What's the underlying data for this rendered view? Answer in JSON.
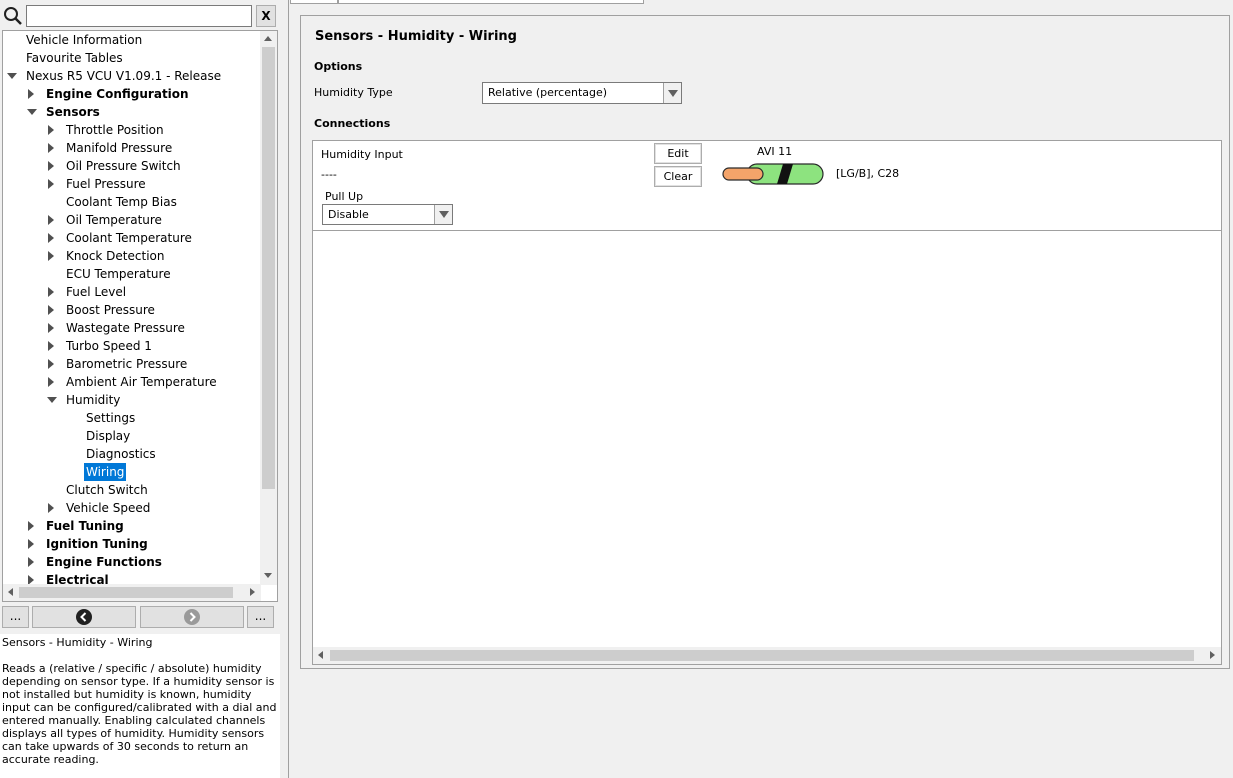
{
  "search": {
    "placeholder": "",
    "value": "",
    "clear_label": "X"
  },
  "tree": {
    "items": [
      {
        "label": "Vehicle Information",
        "level": 0,
        "state": "none",
        "bold": false
      },
      {
        "label": "Favourite Tables",
        "level": 0,
        "state": "none",
        "bold": false
      },
      {
        "label": "Nexus R5 VCU V1.09.1 - Release",
        "level": 0,
        "state": "expanded",
        "bold": false
      },
      {
        "label": "Engine Configuration",
        "level": 1,
        "state": "collapsed",
        "bold": true
      },
      {
        "label": "Sensors",
        "level": 1,
        "state": "expanded",
        "bold": true
      },
      {
        "label": "Throttle Position",
        "level": 2,
        "state": "collapsed",
        "bold": false
      },
      {
        "label": "Manifold Pressure",
        "level": 2,
        "state": "collapsed",
        "bold": false
      },
      {
        "label": "Oil Pressure Switch",
        "level": 2,
        "state": "collapsed",
        "bold": false
      },
      {
        "label": "Fuel Pressure",
        "level": 2,
        "state": "collapsed",
        "bold": false
      },
      {
        "label": "Coolant Temp Bias",
        "level": 2,
        "state": "none",
        "bold": false
      },
      {
        "label": "Oil Temperature",
        "level": 2,
        "state": "collapsed",
        "bold": false
      },
      {
        "label": "Coolant Temperature",
        "level": 2,
        "state": "collapsed",
        "bold": false
      },
      {
        "label": "Knock Detection",
        "level": 2,
        "state": "collapsed",
        "bold": false
      },
      {
        "label": "ECU Temperature",
        "level": 2,
        "state": "none",
        "bold": false
      },
      {
        "label": "Fuel Level",
        "level": 2,
        "state": "collapsed",
        "bold": false
      },
      {
        "label": "Boost Pressure",
        "level": 2,
        "state": "collapsed",
        "bold": false
      },
      {
        "label": "Wastegate Pressure",
        "level": 2,
        "state": "collapsed",
        "bold": false
      },
      {
        "label": "Turbo Speed 1",
        "level": 2,
        "state": "collapsed",
        "bold": false
      },
      {
        "label": "Barometric Pressure",
        "level": 2,
        "state": "collapsed",
        "bold": false
      },
      {
        "label": "Ambient Air Temperature",
        "level": 2,
        "state": "collapsed",
        "bold": false
      },
      {
        "label": "Humidity",
        "level": 2,
        "state": "expanded",
        "bold": false
      },
      {
        "label": "Settings",
        "level": 3,
        "state": "none",
        "bold": false
      },
      {
        "label": "Display",
        "level": 3,
        "state": "none",
        "bold": false
      },
      {
        "label": "Diagnostics",
        "level": 3,
        "state": "none",
        "bold": false
      },
      {
        "label": "Wiring",
        "level": 3,
        "state": "none",
        "bold": false,
        "selected": true
      },
      {
        "label": "Clutch Switch",
        "level": 2,
        "state": "none",
        "bold": false
      },
      {
        "label": "Vehicle Speed",
        "level": 2,
        "state": "collapsed",
        "bold": false
      },
      {
        "label": "Fuel Tuning",
        "level": 1,
        "state": "collapsed",
        "bold": true
      },
      {
        "label": "Ignition Tuning",
        "level": 1,
        "state": "collapsed",
        "bold": true
      },
      {
        "label": "Engine Functions",
        "level": 1,
        "state": "collapsed",
        "bold": true
      },
      {
        "label": "Electrical",
        "level": 1,
        "state": "collapsed",
        "bold": true
      }
    ]
  },
  "nav": {
    "more_left_label": "...",
    "more_right_label": "..."
  },
  "help": {
    "title": "Sensors - Humidity - Wiring",
    "text": "Reads a (relative / specific / absolute) humidity depending on sensor type. If a humidity sensor is not installed but humidity is known, humidity input can be configured/calibrated with a dial and entered manually. Enabling calculated channels displays all types of humidity. Humidity sensors can take upwards of 30 seconds to return an accurate reading."
  },
  "page": {
    "title": "Sensors - Humidity - Wiring",
    "options_heading": "Options",
    "humidity_type_label": "Humidity Type",
    "humidity_type_value": "Relative (percentage)",
    "connections_heading": "Connections"
  },
  "connection": {
    "input_label": "Humidity Input",
    "input_value": "----",
    "pull_up_label": "Pull Up",
    "pull_up_value": "Disable",
    "edit_label": "Edit",
    "clear_label": "Clear",
    "pin_label": "AVI 11",
    "wire_code": "[LG/B], C28",
    "wire_colors": {
      "core": "#f4a46a",
      "insulation": "#8de37f",
      "stripe": "#111111"
    }
  }
}
